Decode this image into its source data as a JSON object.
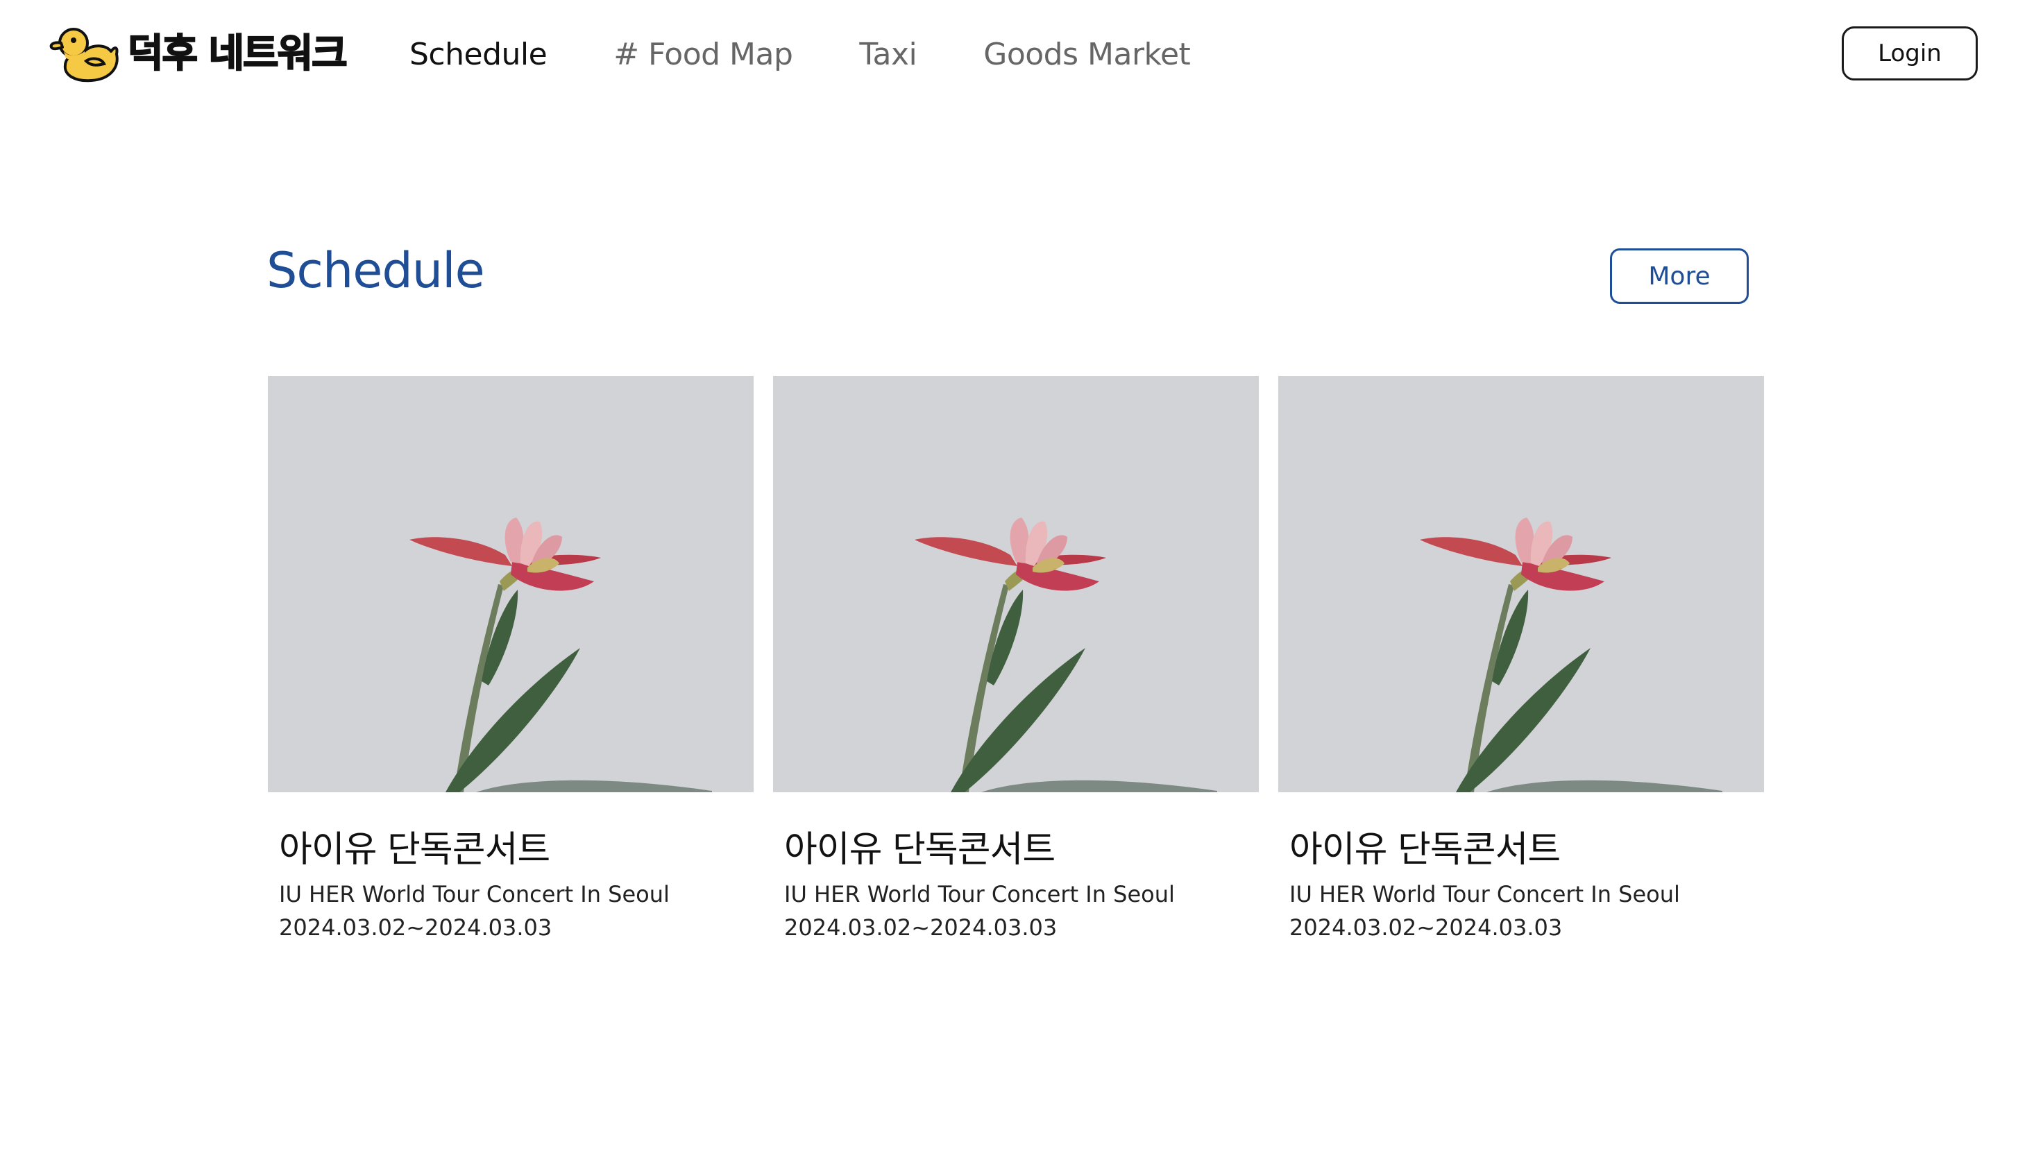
{
  "header": {
    "logo_text": "덕후 네트워크",
    "logo_icon": "duck-icon",
    "nav": [
      {
        "label": "Schedule",
        "active": true
      },
      {
        "label": "# Food Map",
        "active": false
      },
      {
        "label": "Taxi",
        "active": false
      },
      {
        "label": "Goods Market",
        "active": false
      }
    ],
    "login_label": "Login"
  },
  "schedule": {
    "title": "Schedule",
    "more_label": "More",
    "cards": [
      {
        "title": "아이유 단독콘서트",
        "subtitle": "IU HER World Tour Concert In Seoul",
        "date": "2024.03.02~2024.03.03",
        "image": "flower-photo"
      },
      {
        "title": "아이유 단독콘서트",
        "subtitle": "IU HER World Tour Concert In Seoul",
        "date": "2024.03.02~2024.03.03",
        "image": "flower-photo"
      },
      {
        "title": "아이유 단독콘서트",
        "subtitle": "IU HER World Tour Concert In Seoul",
        "date": "2024.03.02~2024.03.03",
        "image": "flower-photo"
      }
    ]
  },
  "colors": {
    "accent": "#1f4e96",
    "duck_yellow": "#f6c945",
    "image_bg": "#d2d3d6"
  }
}
